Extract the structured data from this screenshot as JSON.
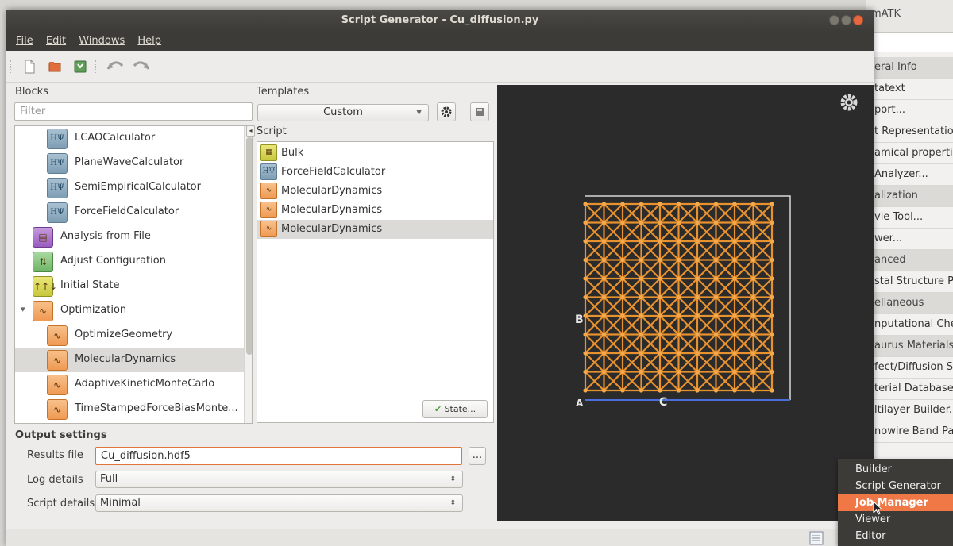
{
  "window": {
    "title": "Script Generator - Cu_diffusion.py"
  },
  "menubar": [
    "File",
    "Edit",
    "Windows",
    "Help"
  ],
  "toolbar": {
    "icons": [
      "new-file-icon",
      "open-folder-icon",
      "save-icon",
      "undo-icon",
      "redo-icon"
    ]
  },
  "blocks": {
    "label": "Blocks",
    "filter_placeholder": "Filter",
    "items": [
      {
        "label": "LCAOCalculator",
        "icon": "calculator-icon",
        "indent": 2
      },
      {
        "label": "PlaneWaveCalculator",
        "icon": "calculator-icon",
        "indent": 2
      },
      {
        "label": "SemiEmpiricalCalculator",
        "icon": "calculator-icon",
        "indent": 2
      },
      {
        "label": "ForceFieldCalculator",
        "icon": "calculator-icon",
        "indent": 2
      },
      {
        "label": "Analysis from File",
        "icon": "analysis-icon",
        "indent": 1
      },
      {
        "label": "Adjust Configuration",
        "icon": "adjust-icon",
        "indent": 1
      },
      {
        "label": "Initial State",
        "icon": "initial-state-icon",
        "indent": 1
      },
      {
        "label": "Optimization",
        "icon": "optimization-icon",
        "indent": 1,
        "expanded": true
      },
      {
        "label": "OptimizeGeometry",
        "icon": "optimization-icon",
        "indent": 2
      },
      {
        "label": "MolecularDynamics",
        "icon": "optimization-icon",
        "indent": 2,
        "selected": true
      },
      {
        "label": "AdaptiveKineticMonteCarlo",
        "icon": "optimization-icon",
        "indent": 2
      },
      {
        "label": "TimeStampedForceBiasMonte...",
        "icon": "optimization-icon",
        "indent": 2
      }
    ]
  },
  "templates": {
    "label": "Templates",
    "selected": "Custom"
  },
  "script": {
    "label": "Script",
    "items": [
      {
        "label": "Bulk",
        "icon": "bulk-icon"
      },
      {
        "label": "ForceFieldCalculator",
        "icon": "calculator-icon"
      },
      {
        "label": "MolecularDynamics",
        "icon": "optimization-icon"
      },
      {
        "label": "MolecularDynamics",
        "icon": "optimization-icon"
      },
      {
        "label": "MolecularDynamics",
        "icon": "optimization-icon",
        "selected": true
      }
    ],
    "state_button": "State..."
  },
  "viewer": {
    "axis_b": "B",
    "axis_c": "C",
    "axis_a": "A"
  },
  "output": {
    "title": "Output settings",
    "results_label": "Results file",
    "results_value": "Cu_diffusion.hdf5",
    "browse": "...",
    "log_label": "Log details",
    "log_value": "Full",
    "script_label": "Script details",
    "script_value": "Minimal"
  },
  "background_app": {
    "title": "mATK",
    "items": [
      {
        "label": "eral Info",
        "section": true
      },
      {
        "label": "tatext"
      },
      {
        "label": "port..."
      },
      {
        "label": "t Representatio"
      },
      {
        "label": "amical propertie"
      },
      {
        "label": "Analyzer..."
      },
      {
        "label": "alization",
        "section": true
      },
      {
        "label": "vie Tool..."
      },
      {
        "label": "wer..."
      },
      {
        "label": "anced",
        "section": true
      },
      {
        "label": "stal Structure Pr"
      },
      {
        "label": "ellaneous",
        "section": true
      },
      {
        "label": "nputational Che"
      },
      {
        "label": "aurus Materials",
        "section": true
      },
      {
        "label": "fect/Diffusion Sc"
      },
      {
        "label": "terial Database..."
      },
      {
        "label": "ltilayer Builder..."
      },
      {
        "label": "nowire Band Par"
      }
    ]
  },
  "context_menu": {
    "items": [
      {
        "label": "Builder"
      },
      {
        "label": "Script Generator"
      },
      {
        "label": "Job Manager",
        "active": true
      },
      {
        "label": "Viewer"
      },
      {
        "label": "Editor"
      }
    ]
  }
}
